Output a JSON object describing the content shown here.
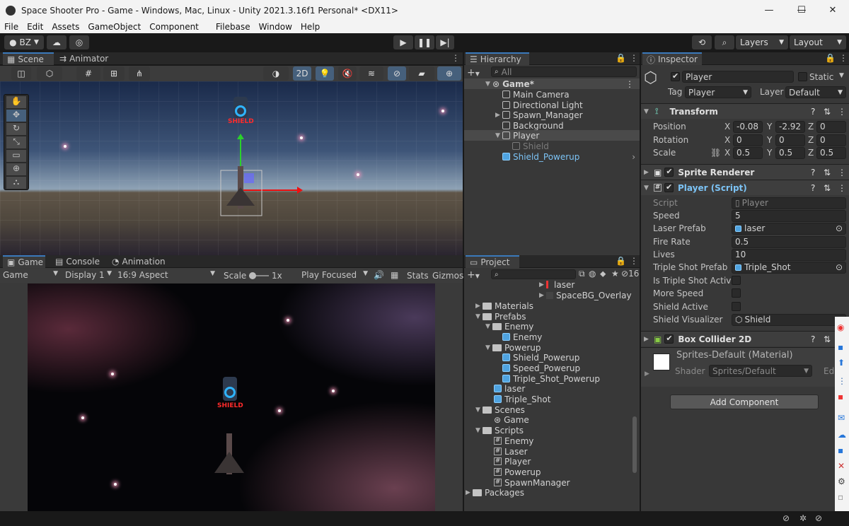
{
  "window": {
    "title": "Space Shooter Pro - Game - Windows, Mac, Linux - Unity 2021.3.16f1 Personal* <DX11>"
  },
  "menu": [
    "File",
    "Edit",
    "Assets",
    "GameObject",
    "Component",
    "Filebase",
    "Window",
    "Help"
  ],
  "toolbar": {
    "account": "BZ",
    "layers": "Layers",
    "layout": "Layout"
  },
  "scene_panel": {
    "tabs": [
      "Scene",
      "Animator"
    ],
    "mode_2d": "2D",
    "shield_label": "SHIELD"
  },
  "game_panel": {
    "tabs": [
      "Game",
      "Console",
      "Animation"
    ],
    "display_mode": "Game",
    "display": "Display 1",
    "aspect": "16:9 Aspect",
    "scale_label": "Scale",
    "scale_value": "1x",
    "play_focused": "Play Focused",
    "stats": "Stats",
    "gizmos": "Gizmos",
    "shield_label": "SHIELD"
  },
  "hierarchy": {
    "title": "Hierarchy",
    "search_placeholder": "All",
    "scene": "Game*",
    "items": [
      "Main Camera",
      "Directional Light",
      "Spawn_Manager",
      "Background",
      "Player",
      "Shield",
      "Shield_Powerup"
    ]
  },
  "project": {
    "title": "Project",
    "hidden_count": "16",
    "items": [
      "laser",
      "SpaceBG_Overlay",
      "Materials",
      "Prefabs",
      "Enemy",
      "Enemy",
      "Powerup",
      "Shield_Powerup",
      "Speed_Powerup",
      "Triple_Shot_Powerup",
      "laser",
      "Triple_Shot",
      "Scenes",
      "Game",
      "Scripts",
      "Enemy",
      "Laser",
      "Player",
      "Powerup",
      "SpawnManager",
      "Packages"
    ]
  },
  "inspector": {
    "title": "Inspector",
    "object_name": "Player",
    "static_label": "Static",
    "tag_label": "Tag",
    "tag_value": "Player",
    "layer_label": "Layer",
    "layer_value": "Default",
    "transform": {
      "title": "Transform",
      "position_label": "Position",
      "pos_x": "-0.08",
      "pos_y": "-2.92",
      "pos_z": "0",
      "rotation_label": "Rotation",
      "rot_x": "0",
      "rot_y": "0",
      "rot_z": "0",
      "scale_label": "Scale",
      "scale_x": "0.5",
      "scale_y": "0.5",
      "scale_z": "0.5"
    },
    "sprite_renderer": "Sprite Renderer",
    "player_script": {
      "title": "Player (Script)",
      "script_label": "Script",
      "script_value": "Player",
      "speed_label": "Speed",
      "speed_value": "5",
      "laser_prefab_label": "Laser Prefab",
      "laser_prefab_value": "laser",
      "fire_rate_label": "Fire Rate",
      "fire_rate_value": "0.5",
      "lives_label": "Lives",
      "lives_value": "10",
      "triple_shot_prefab_label": "Triple Shot Prefab",
      "triple_shot_prefab_value": "Triple_Shot",
      "triple_shot_active_label": "Is Triple Shot Active",
      "more_speed_label": "More Speed",
      "shield_active_label": "Shield Active",
      "shield_visualizer_label": "Shield Visualizer",
      "shield_visualizer_value": "Shield"
    },
    "box_collider": "Box Collider 2D",
    "material": {
      "name": "Sprites-Default (Material)",
      "shader_label": "Shader",
      "shader_value": "Sprites/Default",
      "edit": "Edit..."
    },
    "add_component": "Add Component"
  },
  "colors": {
    "accent": "#3a79bb",
    "selection": "#2c5d87",
    "prefab_blue": "#7cc3f5"
  }
}
